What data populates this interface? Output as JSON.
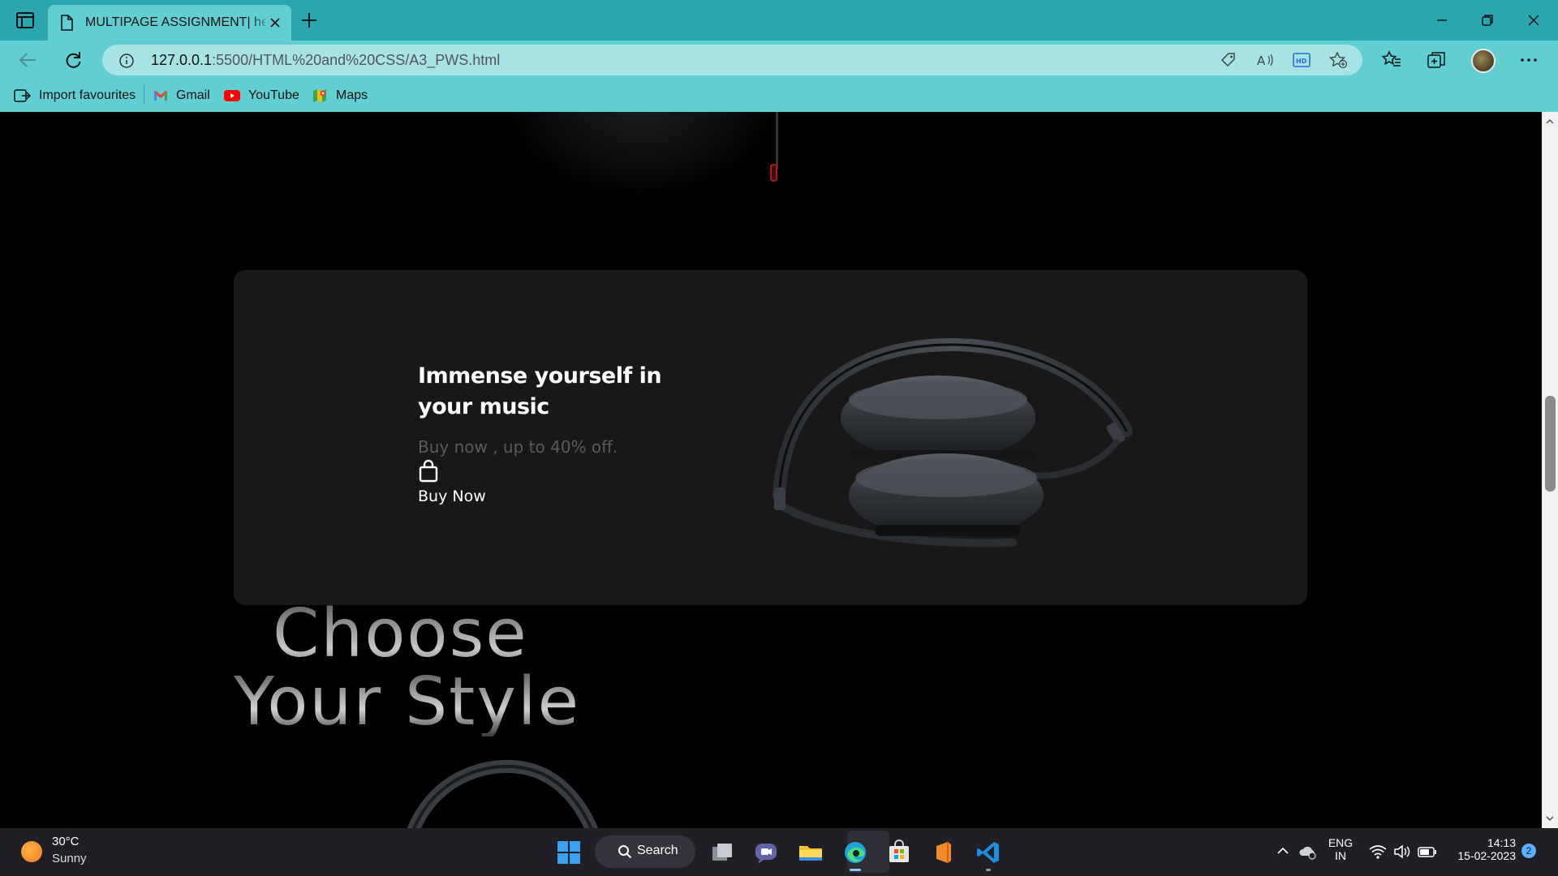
{
  "browser": {
    "tab_title": "MULTIPAGE ASSIGNMENT| headphones",
    "url_host": "127.0.0.1",
    "url_rest": ":5500/HTML%20and%20CSS/A3_PWS.html"
  },
  "favourites": [
    {
      "label": "Import favourites",
      "icon": "import-icon"
    },
    {
      "label": "Gmail",
      "icon": "gmail-icon"
    },
    {
      "label": "YouTube",
      "icon": "youtube-icon"
    },
    {
      "label": "Maps",
      "icon": "maps-icon"
    }
  ],
  "page": {
    "promo_title": "Immense yourself in your music",
    "promo_subtitle": "Buy now , up to 40% off.",
    "buy_label": "Buy Now",
    "section_heading_line1": "Choose",
    "section_heading_line2": "Your Style"
  },
  "taskbar": {
    "temperature": "30°C",
    "condition": "Sunny",
    "search_label": "Search",
    "language_line1": "ENG",
    "language_line2": "IN",
    "time": "14:13",
    "date": "15-02-2023",
    "notification_count": "2"
  },
  "colors": {
    "titlebar": "#2ba6ae",
    "toolbar": "#61cfd1",
    "card": "#191718",
    "taskbar": "#1f1f25"
  }
}
